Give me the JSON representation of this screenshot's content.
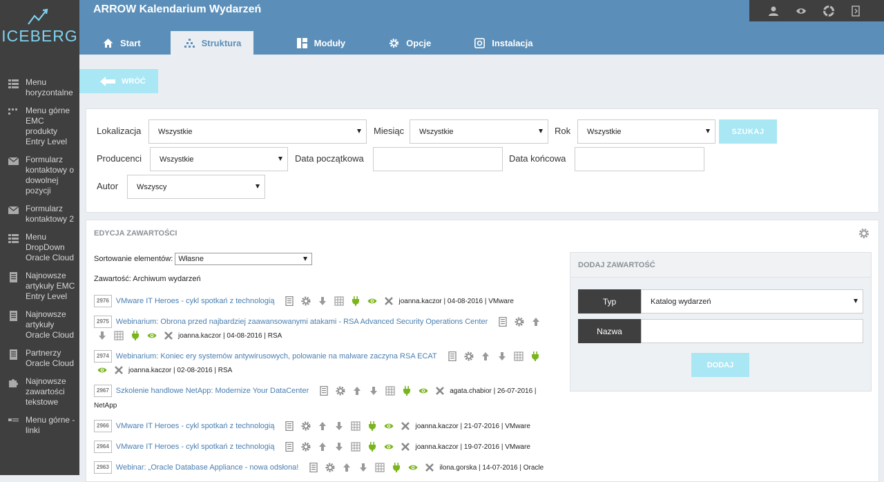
{
  "colors": {
    "accent": "#5b8fb9",
    "sidebar": "#3f3f3f",
    "button": "#a9e7f5",
    "link": "#4a7eb0",
    "green": "#7ab51d"
  },
  "sidebar": {
    "logo": "ICEBERG",
    "items": [
      {
        "label": "Menu horyzontalne",
        "icon": "grid-list-icon"
      },
      {
        "label": "Menu górne EMC produkty Entry Level",
        "icon": "menu-dots-icon"
      },
      {
        "label": "Formularz kontaktowy o dowolnej pozycji",
        "icon": "envelope-icon"
      },
      {
        "label": "Formularz kontaktowy 2",
        "icon": "envelope-icon"
      },
      {
        "label": "Menu DropDown Oracle Cloud",
        "icon": "grid-list-icon"
      },
      {
        "label": "Najnowsze artykuły EMC Entry Level",
        "icon": "document-icon"
      },
      {
        "label": "Najnowsze artykuły Oracle Cloud",
        "icon": "document-icon"
      },
      {
        "label": "Partnerzy Oracle Cloud",
        "icon": "document-icon"
      },
      {
        "label": "Najnowsze zawartości tekstowe",
        "icon": "puzzle-icon"
      },
      {
        "label": "Menu górne - linki",
        "icon": "menu-lines-icon"
      }
    ]
  },
  "header": {
    "title": "ARROW Kalendarium Wydarzeń",
    "tabs": [
      {
        "label": "Start",
        "icon": "home-icon"
      },
      {
        "label": "Struktura",
        "icon": "sitemap-icon"
      },
      {
        "label": "Moduły",
        "icon": "modules-icon"
      },
      {
        "label": "Opcje",
        "icon": "gear-icon"
      },
      {
        "label": "Instalacja",
        "icon": "install-icon"
      }
    ]
  },
  "back_label": "WRÓĆ",
  "filters": {
    "lokalizacja_label": "Lokalizacja",
    "lokalizacja_value": "Wszystkie",
    "miesiac_label": "Miesiąc",
    "miesiac_value": "Wszystkie",
    "rok_label": "Rok",
    "rok_value": "Wszystkie",
    "search_label": "SZUKAJ",
    "producenci_label": "Producenci",
    "producenci_value": "Wszystkie",
    "data_pocz_label": "Data początkowa",
    "data_konc_label": "Data końcowa",
    "autor_label": "Autor",
    "autor_value": "Wszyscy"
  },
  "content": {
    "title": "EDYCJA ZAWARTOŚCI",
    "sort_label": "Sortowanie elementów:",
    "sort_value": "Własne",
    "content_label": "Zawartość: Archiwum wydarzeń",
    "items": [
      {
        "id": "2976",
        "title": "VMware IT Heroes - cykl spotkań z technologią",
        "meta": "joanna.kaczor | 04-08-2016 | VMware"
      },
      {
        "id": "2975",
        "title": "Webinarium: Obrona przed najbardziej zaawansowanymi atakami - RSA Advanced Security Operations Center",
        "meta": "joanna.kaczor | 04-08-2016 | RSA"
      },
      {
        "id": "2974",
        "title": "Webinarium: Koniec ery systemów antywirusowych, polowanie na malware zaczyna RSA ECAT",
        "meta": "joanna.kaczor | 02-08-2016 | RSA"
      },
      {
        "id": "2967",
        "title": "Szkolenie handlowe NetApp: Modernize Your DataCenter",
        "meta": "agata.chabior | 26-07-2016 | NetApp"
      },
      {
        "id": "2966",
        "title": "VMware IT Heroes - cykl spotkań z technologią",
        "meta": "joanna.kaczor | 21-07-2016 | VMware"
      },
      {
        "id": "2964",
        "title": "VMware IT Heroes - cykl spotkań z technologią",
        "meta": "joanna.kaczor | 19-07-2016 | VMware"
      },
      {
        "id": "2963",
        "title": "Webinar: „Oracle Database Appliance - nowa odsłona!",
        "meta": "ilona.gorska | 14-07-2016 | Oracle"
      }
    ]
  },
  "add": {
    "title": "DODAJ ZAWARTOŚĆ",
    "typ_label": "Typ",
    "typ_value": "Katalog wydarzeń",
    "nazwa_label": "Nazwa",
    "button": "DODAJ"
  }
}
